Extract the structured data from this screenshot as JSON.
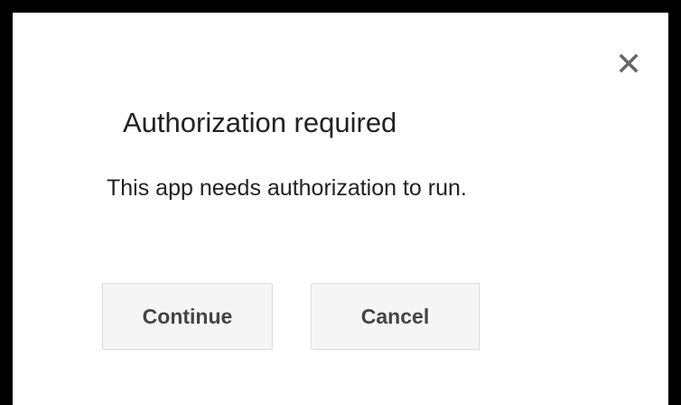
{
  "dialog": {
    "title": "Authorization required",
    "message": "This app needs authorization to run.",
    "close_icon": "close-icon",
    "buttons": {
      "continue_label": "Continue",
      "cancel_label": "Cancel"
    }
  },
  "colors": {
    "backdrop": "#000000",
    "dialog_background": "#ffffff",
    "text": "#222222",
    "button_background": "#f5f5f5",
    "button_border": "#dcdcdc",
    "button_text": "#444444",
    "close_icon": "#666666"
  }
}
